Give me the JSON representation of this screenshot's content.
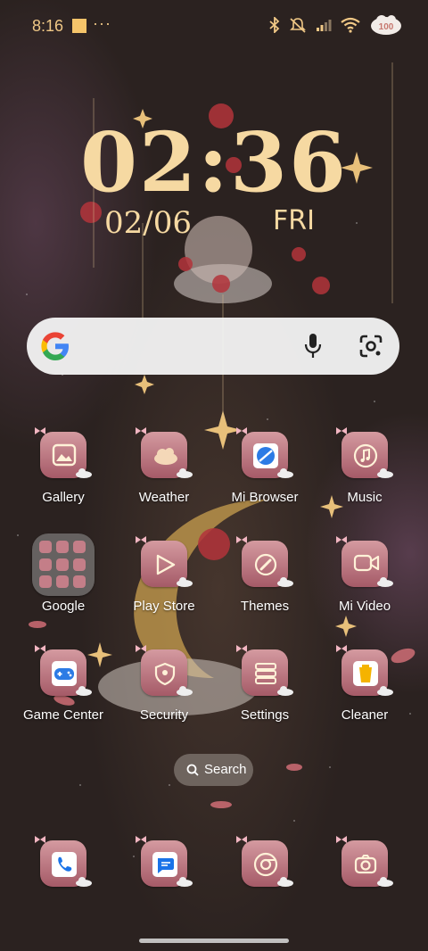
{
  "status_bar": {
    "time": "8:16",
    "more_dots": "···",
    "battery_badge": "100"
  },
  "clock_widget": {
    "time": "02:36",
    "date": "02/06",
    "day": "FRI"
  },
  "google_search": {
    "logo_letter": "G"
  },
  "apps": [
    {
      "label": "Gallery"
    },
    {
      "label": "Weather"
    },
    {
      "label": "Mi Browser"
    },
    {
      "label": "Music"
    },
    {
      "label": "Google"
    },
    {
      "label": "Play Store"
    },
    {
      "label": "Themes"
    },
    {
      "label": "Mi Video"
    },
    {
      "label": "Game Center"
    },
    {
      "label": "Security"
    },
    {
      "label": "Settings"
    },
    {
      "label": "Cleaner"
    }
  ],
  "app_search": {
    "label": "Search"
  },
  "dock": [
    {
      "icon": "phone-icon"
    },
    {
      "icon": "messages-icon"
    },
    {
      "icon": "chrome-icon"
    },
    {
      "icon": "camera-icon"
    }
  ],
  "colors": {
    "accent_gold": "#f6d9a2",
    "status_gold": "#f0c886",
    "tile_rose": "#c47e88",
    "background": "#2b2220"
  }
}
